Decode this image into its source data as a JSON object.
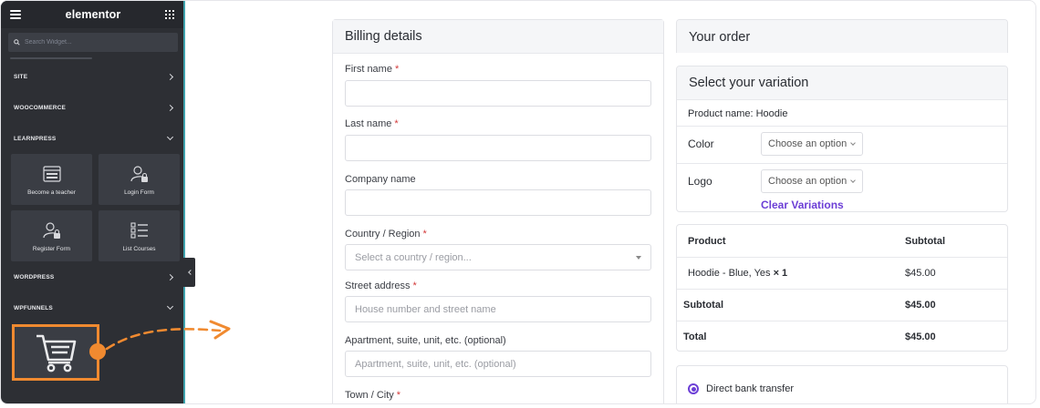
{
  "sidebar": {
    "brand": "elementor",
    "search_placeholder": "Search Widget...",
    "categories": {
      "site": "SITE",
      "woocommerce": "WOOCOMMERCE",
      "learnpress": "LEARNPRESS",
      "wordpress": "WORDPRESS",
      "wpfunnels": "WPFUNNELS"
    },
    "widgets": {
      "become_teacher": "Become a teacher",
      "login_form": "Login Form",
      "register_form": "Register Form",
      "list_courses": "List Courses"
    }
  },
  "billing": {
    "title": "Billing details",
    "required_mark": "*",
    "first_name": "First name",
    "last_name": "Last name",
    "company": "Company name",
    "country": "Country / Region",
    "country_placeholder": "Select a country / region...",
    "street": "Street address",
    "street_placeholder": "House number and street name",
    "apartment": "Apartment, suite, unit, etc. (optional)",
    "apartment_placeholder": "Apartment, suite, unit, etc. (optional)",
    "town": "Town / City"
  },
  "order": {
    "title": "Your order",
    "variation_title": "Select your variation",
    "product_name": "Product name: Hoodie",
    "color_label": "Color",
    "logo_label": "Logo",
    "choose_option": "Choose an option",
    "clear_variations": "Clear Variations",
    "table": {
      "col_product": "Product",
      "col_subtotal": "Subtotal",
      "item_name": "Hoodie - Blue, Yes",
      "item_qty": "× 1",
      "item_price": "$45.00",
      "subtotal_label": "Subtotal",
      "subtotal_value": "$45.00",
      "total_label": "Total",
      "total_value": "$45.00"
    },
    "payment_method": "Direct bank transfer"
  },
  "colors": {
    "accent": "#6c3fd6",
    "highlight": "#f08a30",
    "sidebar_bg": "#2d2f34"
  }
}
